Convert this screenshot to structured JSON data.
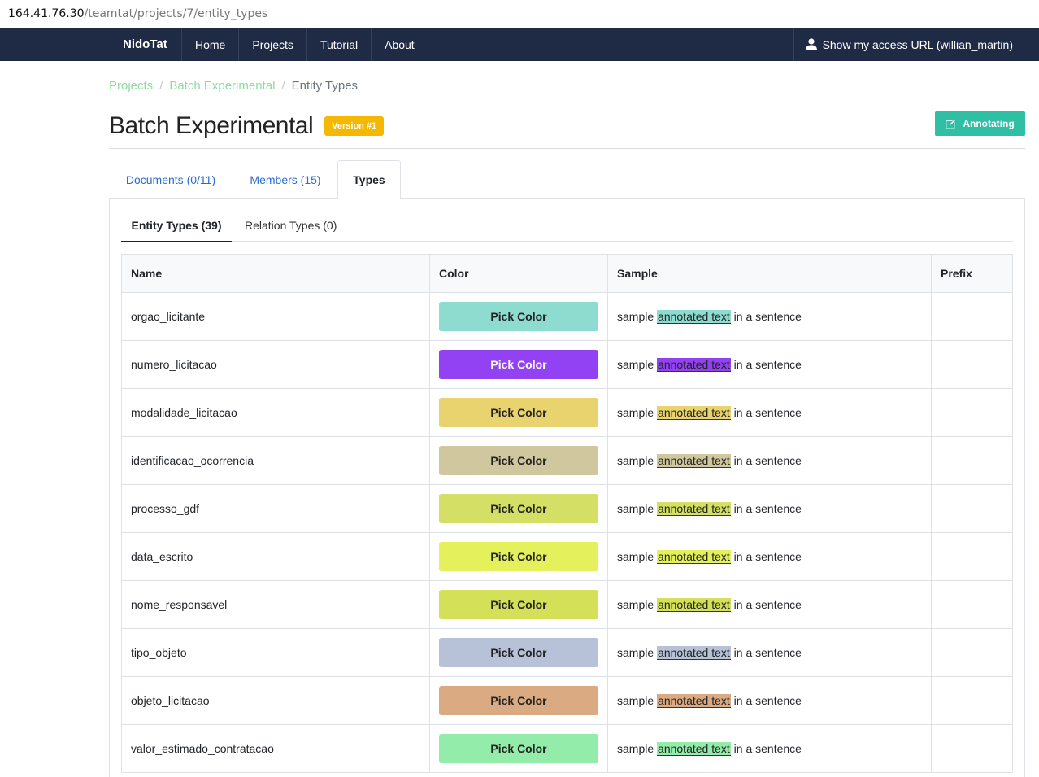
{
  "url": {
    "host": "164.41.76.30",
    "path": "/teamtat/projects/7/entity_types"
  },
  "navbar": {
    "brand": "NidoTat",
    "items": [
      "Home",
      "Projects",
      "Tutorial",
      "About"
    ],
    "user_link": "Show my access URL (willian_martin)",
    "user_icon": "user-icon"
  },
  "breadcrumb": {
    "items": [
      "Projects",
      "Batch Experimental",
      "Entity Types"
    ],
    "separator": "/"
  },
  "page": {
    "title": "Batch Experimental",
    "version_badge": "Version #1",
    "annotating_button": "Annotating"
  },
  "tabs": [
    {
      "label": "Documents (0/11)",
      "active": false
    },
    {
      "label": "Members (15)",
      "active": false
    },
    {
      "label": "Types",
      "active": true
    }
  ],
  "subtabs": [
    {
      "label": "Entity Types (39)",
      "active": true
    },
    {
      "label": "Relation Types (0)",
      "active": false
    }
  ],
  "table": {
    "headers": {
      "name": "Name",
      "color": "Color",
      "sample": "Sample",
      "prefix": "Prefix"
    },
    "pick_label": "Pick Color",
    "sample_text": {
      "before": "sample",
      "highlight": "annotated text",
      "after": "in a sentence"
    },
    "rows": [
      {
        "name": "orgao_licitante",
        "color": "#8ddccf",
        "text_color": "#222",
        "prefix": ""
      },
      {
        "name": "numero_licitacao",
        "color": "#9242f2",
        "text_color": "#ffffff",
        "prefix": ""
      },
      {
        "name": "modalidade_licitacao",
        "color": "#e8d36e",
        "text_color": "#222",
        "prefix": ""
      },
      {
        "name": "identificacao_ocorrencia",
        "color": "#d0c79e",
        "text_color": "#222",
        "prefix": ""
      },
      {
        "name": "processo_gdf",
        "color": "#d4e065",
        "text_color": "#222",
        "prefix": ""
      },
      {
        "name": "data_escrito",
        "color": "#e4f15c",
        "text_color": "#222",
        "prefix": ""
      },
      {
        "name": "nome_responsavel",
        "color": "#d3e058",
        "text_color": "#222",
        "prefix": ""
      },
      {
        "name": "tipo_objeto",
        "color": "#b7c1d8",
        "text_color": "#222",
        "prefix": ""
      },
      {
        "name": "objeto_licitacao",
        "color": "#daab83",
        "text_color": "#222",
        "prefix": ""
      },
      {
        "name": "valor_estimado_contratacao",
        "color": "#93eca9",
        "text_color": "#222",
        "prefix": ""
      }
    ]
  },
  "colors": {
    "navbar": "#1f2a44",
    "accent": "#2ebfa5",
    "badge": "#f5b800",
    "link": "#2a6cd0",
    "breadcrumb_link": "#8fdca0"
  }
}
